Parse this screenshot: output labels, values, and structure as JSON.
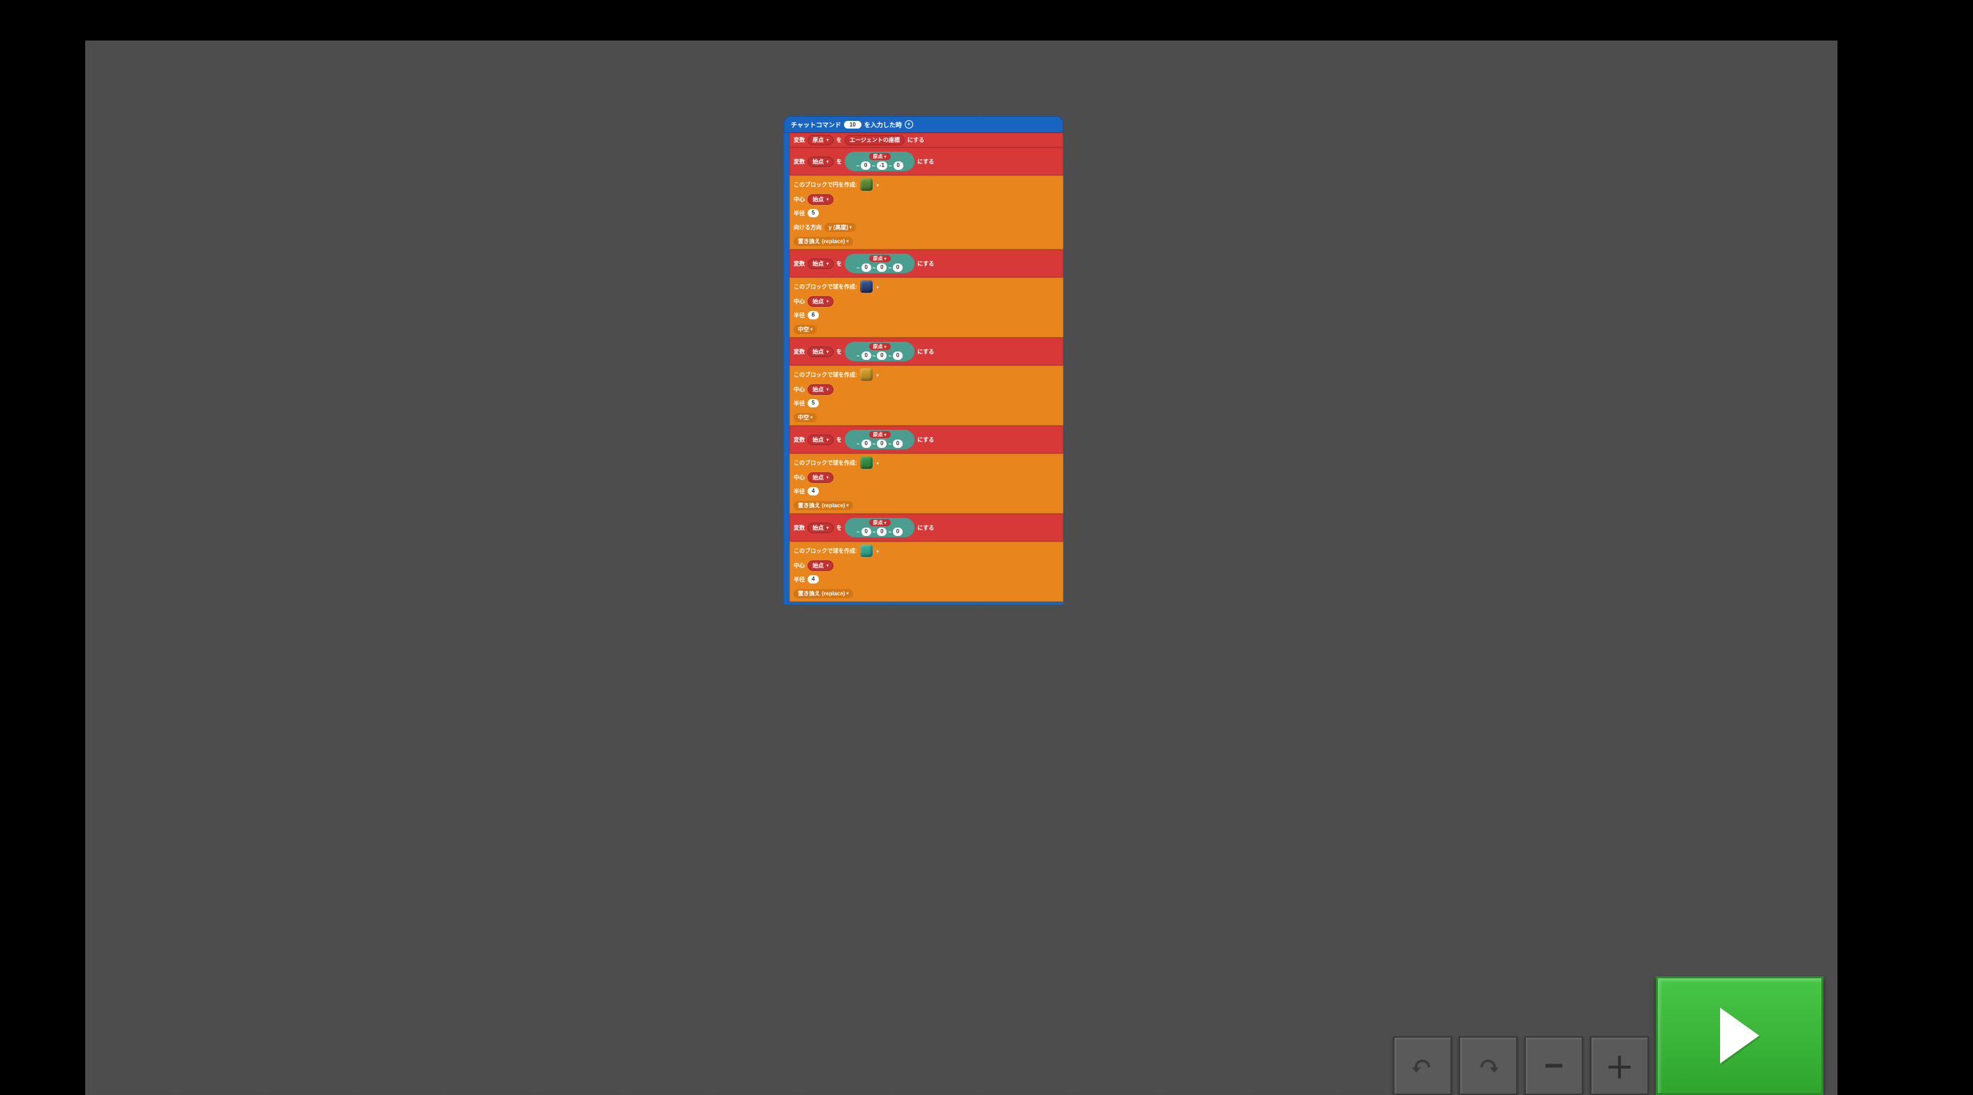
{
  "hat": {
    "prefix": "チャットコマンド",
    "command": "10",
    "suffix": "を入力した時"
  },
  "labels": {
    "set_var": "変数",
    "to_wo": "を",
    "to_ni": "にする",
    "agent_coord": "エージェントの座標",
    "origin": "原点",
    "start": "始点",
    "circle_header": "このブロックで円を作成:",
    "sphere_header": "このブロックで球を作成:",
    "center": "中心",
    "radius": "半径",
    "orientation": "向ける方向",
    "y_altitude": "y (高度)",
    "replace": "置き換え (replace)",
    "hollow": "中空"
  },
  "blocks": [
    {
      "type": "set_simple",
      "var": "origin",
      "value_kind": "agent"
    },
    {
      "type": "set_coord",
      "var": "start",
      "coord": {
        "base": "origin",
        "x": "0",
        "y": "-1",
        "z": "0"
      }
    },
    {
      "type": "circle",
      "swatch": "grass",
      "center": "start",
      "radius": "5",
      "orientation": true,
      "replace": true
    },
    {
      "type": "set_coord",
      "var": "start",
      "coord": {
        "base": "origin",
        "x": "0",
        "y": "0",
        "z": "0"
      }
    },
    {
      "type": "sphere",
      "swatch": "blue",
      "center": "start",
      "radius": "6",
      "hollow": true
    },
    {
      "type": "set_coord",
      "var": "start",
      "coord": {
        "base": "origin",
        "x": "0",
        "y": "0",
        "z": "0"
      }
    },
    {
      "type": "sphere",
      "swatch": "yellow",
      "center": "start",
      "radius": "5",
      "hollow": true
    },
    {
      "type": "set_coord",
      "var": "start",
      "coord": {
        "base": "origin",
        "x": "0",
        "y": "0",
        "z": "0"
      }
    },
    {
      "type": "sphere",
      "swatch": "green",
      "center": "start",
      "radius": "4",
      "replace": true
    },
    {
      "type": "set_coord",
      "var": "start",
      "coord": {
        "base": "origin",
        "x": "0",
        "y": "0",
        "z": "0"
      }
    },
    {
      "type": "sphere",
      "swatch": "cyan",
      "center": "start",
      "radius": "4",
      "replace": true
    }
  ],
  "toolbar": {
    "undo": "↶",
    "redo": "↷",
    "minus": "−",
    "plus": "＋"
  }
}
